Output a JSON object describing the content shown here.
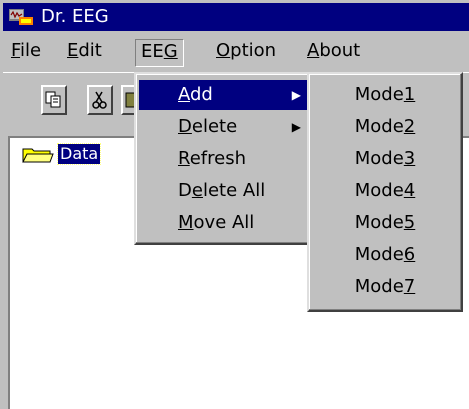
{
  "window": {
    "title": "Dr. EEG",
    "titlebar_color": "#000080"
  },
  "menubar": {
    "items": [
      {
        "pre": "",
        "key": "F",
        "post": "ile"
      },
      {
        "pre": "",
        "key": "E",
        "post": "dit"
      },
      {
        "pre": "EE",
        "key": "G",
        "post": ""
      },
      {
        "pre": "",
        "key": "O",
        "post": "ption"
      },
      {
        "pre": "",
        "key": "A",
        "post": "bout"
      }
    ]
  },
  "toolbar": {
    "icons": [
      "copy-icon",
      "cut-icon",
      "paste-icon"
    ]
  },
  "tree": {
    "items": [
      {
        "label": "Data",
        "icon": "folder-icon"
      }
    ]
  },
  "eeg_menu": {
    "items": [
      {
        "pre": "",
        "key": "A",
        "post": "dd",
        "submenu": true,
        "highlighted": true
      },
      {
        "pre": "",
        "key": "D",
        "post": "elete",
        "submenu": true,
        "highlighted": false
      },
      {
        "pre": "",
        "key": "R",
        "post": "efresh",
        "submenu": false,
        "highlighted": false
      },
      {
        "pre": "D",
        "key": "e",
        "post": "lete All",
        "submenu": false,
        "highlighted": false
      },
      {
        "pre": "",
        "key": "M",
        "post": "ove All",
        "submenu": false,
        "highlighted": false
      }
    ],
    "arrow_glyph": "▶"
  },
  "add_submenu": {
    "items": [
      {
        "pre": "Mode",
        "key": "1"
      },
      {
        "pre": "Mode",
        "key": "2"
      },
      {
        "pre": "Mode",
        "key": "3"
      },
      {
        "pre": "Mode",
        "key": "4"
      },
      {
        "pre": "Mode",
        "key": "5"
      },
      {
        "pre": "Mode",
        "key": "6"
      },
      {
        "pre": "Mode",
        "key": "7"
      }
    ]
  },
  "colors": {
    "face": "#c0c0c0",
    "highlight": "#000080",
    "tree_bg": "#ffffff"
  }
}
